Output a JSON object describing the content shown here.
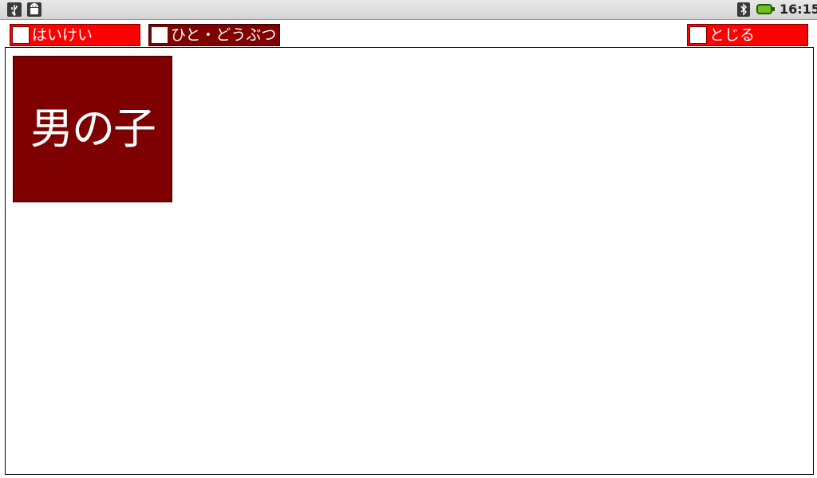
{
  "status_bar": {
    "time": "16:15",
    "icons": [
      "usb-icon",
      "android-debug-icon",
      "bluetooth-icon",
      "battery-icon"
    ],
    "battery_color": "#6cc21a"
  },
  "tabs": [
    {
      "label": "はいけい",
      "checked": false,
      "color": "#ff0000"
    },
    {
      "label": "ひと・どうぶつ",
      "checked": false,
      "color": "#7f0000",
      "selected": true
    },
    {
      "label": "とじる",
      "checked": false,
      "color": "#ff0000"
    }
  ],
  "content": {
    "tiles": [
      {
        "label": "男の子",
        "color": "#7f0000"
      }
    ]
  },
  "colors": {
    "accent_red": "#ff0000",
    "dark_red": "#7f0000",
    "background": "#ffffff"
  }
}
